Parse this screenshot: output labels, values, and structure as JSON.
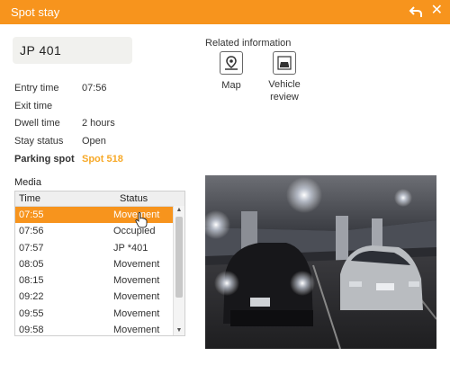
{
  "window": {
    "title": "Spot stay"
  },
  "plate": {
    "number": "JP  401"
  },
  "details": [
    {
      "label": "Entry time",
      "value": "07:56"
    },
    {
      "label": "Exit time",
      "value": ""
    },
    {
      "label": "Dwell time",
      "value": "2 hours"
    },
    {
      "label": "Stay status",
      "value": "Open"
    },
    {
      "label": "Parking spot",
      "value": "Spot 518"
    }
  ],
  "related": {
    "title": "Related information",
    "map_label": "Map",
    "vehicle_review_line1": "Vehicle",
    "vehicle_review_line2": "review"
  },
  "media": {
    "label": "Media",
    "columns": [
      "Time",
      "Status"
    ],
    "rows": [
      {
        "time": "07:55",
        "status": "Movement"
      },
      {
        "time": "07:56",
        "status": "Occupied"
      },
      {
        "time": "07:57",
        "status": "JP  *401"
      },
      {
        "time": "08:05",
        "status": "Movement"
      },
      {
        "time": "08:15",
        "status": "Movement"
      },
      {
        "time": "09:22",
        "status": "Movement"
      },
      {
        "time": "09:55",
        "status": "Movement"
      },
      {
        "time": "09:58",
        "status": "Movement"
      }
    ],
    "selected_index": 0
  },
  "colors": {
    "accent": "#f7941d",
    "spot_link": "#f7a928"
  },
  "icons": {
    "back": "back-arrow-icon",
    "close": "close-icon",
    "map": "map-pin-icon",
    "vehicle_review": "vehicle-camera-icon"
  }
}
